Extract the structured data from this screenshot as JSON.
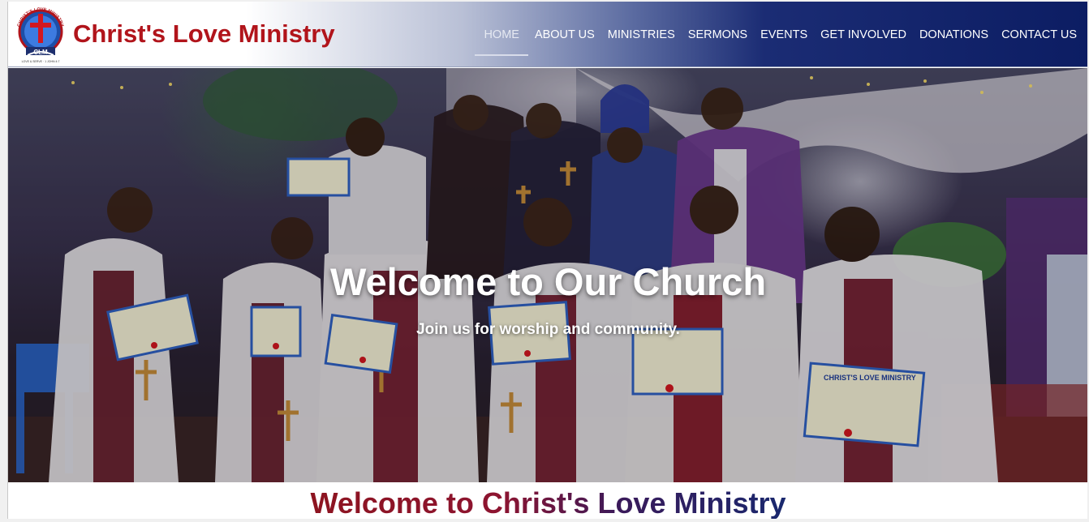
{
  "header": {
    "logo": {
      "ring_text": "CHRIST'S LOVE MINISTRY",
      "initials": "CLM",
      "motto": "LOVE & SERVE · 1 JOHN 4:7"
    },
    "brand": "Christ's Love Ministry",
    "nav": [
      {
        "label": "HOME",
        "active": true
      },
      {
        "label": "ABOUT US",
        "active": false
      },
      {
        "label": "MINISTRIES",
        "active": false
      },
      {
        "label": "SERMONS",
        "active": false
      },
      {
        "label": "EVENTS",
        "active": false
      },
      {
        "label": "GET INVOLVED",
        "active": false
      },
      {
        "label": "DONATIONS",
        "active": false
      },
      {
        "label": "CONTACT US",
        "active": false
      }
    ]
  },
  "hero": {
    "title": "Welcome to Our Church",
    "subtitle": "Join us for worship and community.",
    "certificate_heading": "CHRIST'S LOVE MINISTRY"
  },
  "section": {
    "heading": "Welcome to Christ's Love Ministry"
  },
  "colors": {
    "brand_red": "#b1141b",
    "nav_bg": "#0c1d63",
    "text_white": "#ffffff"
  }
}
